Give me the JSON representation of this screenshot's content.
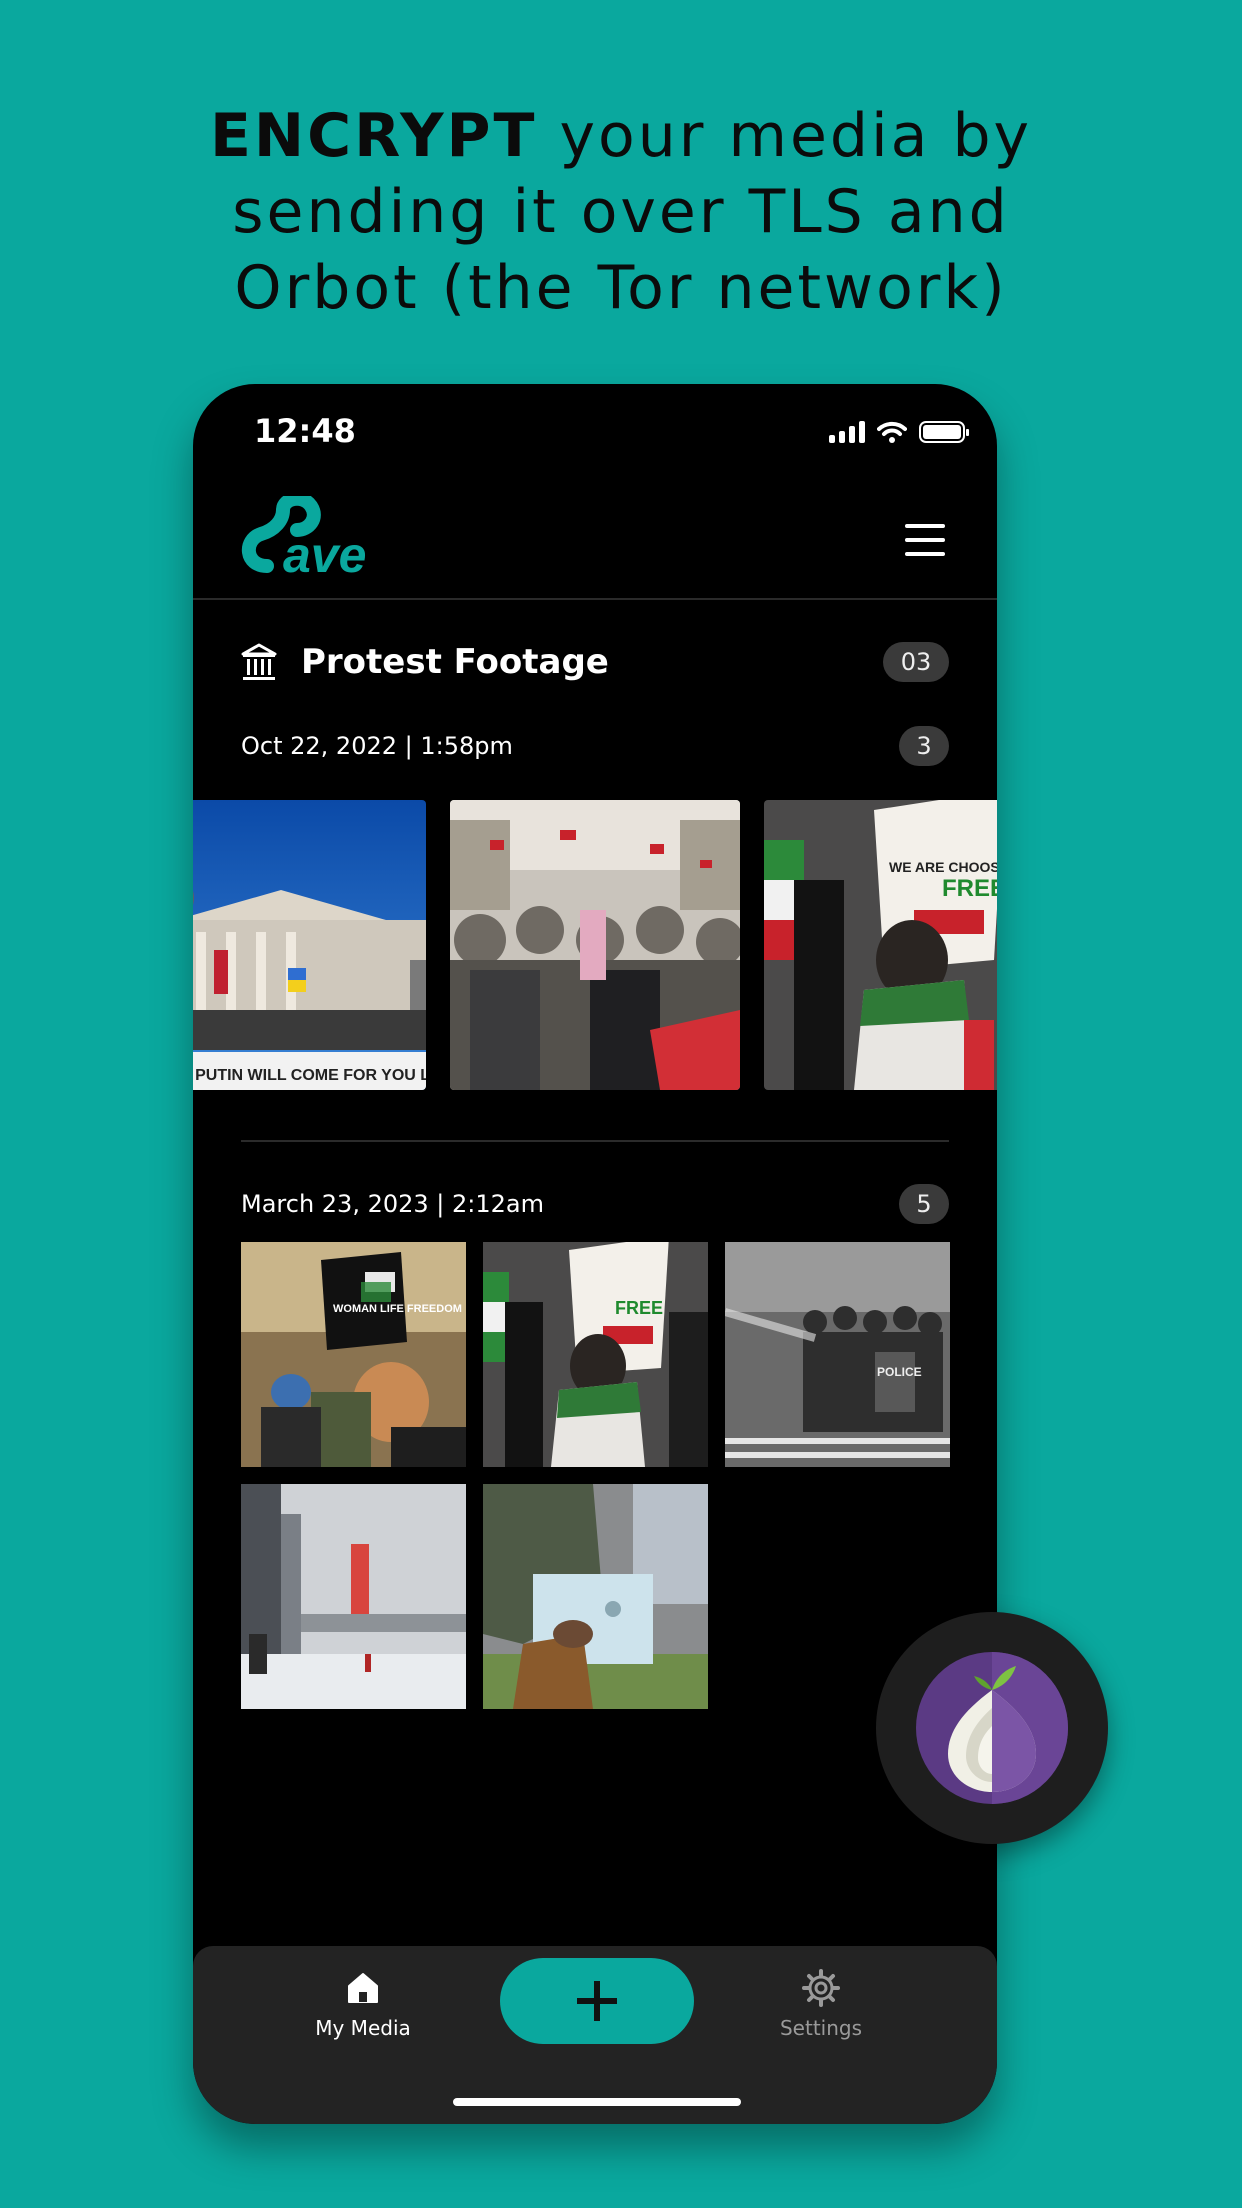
{
  "headline": {
    "bold": "ENCRYPT",
    "rest_line1": " your media by",
    "line2": "sending it over TLS and",
    "line3": "Orbot (the Tor network)"
  },
  "status_bar": {
    "time": "12:48"
  },
  "app": {
    "logo_text": "Save",
    "folder": {
      "title": "Protest Footage",
      "count": "03"
    }
  },
  "groups": [
    {
      "date": "Oct 22, 2022 | 1:58pm",
      "count": "3"
    },
    {
      "date": "March 23, 2023 | 2:12am",
      "count": "5"
    }
  ],
  "photo_text": {
    "banner": "FALLS PUTIN WILL COME FOR YOU LADIES & GENTS",
    "sign_we_are": "WE ARE CHOOSING LIFE",
    "sign_free": "FREE",
    "sign_iran": "WOMAN LIFE FREEDOM",
    "police": "POLICE"
  },
  "tabbar": {
    "my_media": "My Media",
    "settings": "Settings"
  },
  "colors": {
    "accent": "#0aa89e",
    "background": "#000000",
    "tabbar": "#232323"
  }
}
